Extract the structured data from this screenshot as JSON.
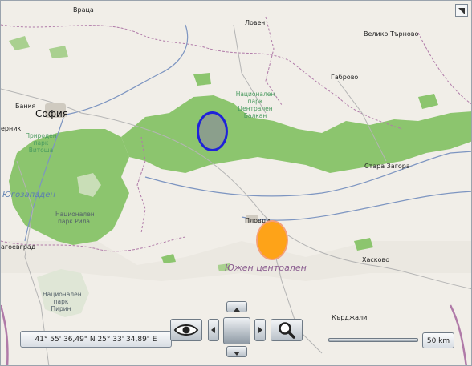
{
  "map": {
    "labels": {
      "vratsa": "Враца",
      "lovech": "Ловеч",
      "veliko_tarnovo": "Велико Търново",
      "gabrovo": "Габрово",
      "bankya": "Банкя",
      "sofia": "София",
      "pernik": "ерник",
      "park_central_balkan": "Национален парк Централен Балкан",
      "park_vitosha": "Природен парк Витоша",
      "stara_zagora": "Стара Загора",
      "region_southwest": "Югозападен",
      "park_rila": "Национален парк Рила",
      "blagoevgrad": "агоевград",
      "plovdiv": "Пловди",
      "region_south_central": "Южен централен",
      "haskovo": "Хасково",
      "park_pirin": "Национален парк Пирин",
      "kardzhali": "Кърджали"
    },
    "shapes": {
      "blue_ellipse": {
        "fill": "#8b9e8e",
        "stroke": "#1a1adf"
      },
      "orange_ellipse": {
        "fill": "#fea318",
        "stroke": "#f4a07a"
      }
    },
    "colors": {
      "land": "#f1eee8",
      "forest": "#8cc56e",
      "border": "#b07aa8",
      "road_blue": "#7d95c1"
    }
  },
  "controls": {
    "coordinates": "41° 55' 36,49\" N 25° 33' 34,89\" E",
    "scale": "50 km",
    "eye_icon": "eye-icon",
    "zoom_icon": "magnifier-icon",
    "pan_up_icon": "triangle-up-icon",
    "pan_down_icon": "triangle-down-icon",
    "pan_left_icon": "triangle-left-icon",
    "pan_right_icon": "triangle-right-icon",
    "fullscreen_icon": "corner-arrow-icon"
  }
}
